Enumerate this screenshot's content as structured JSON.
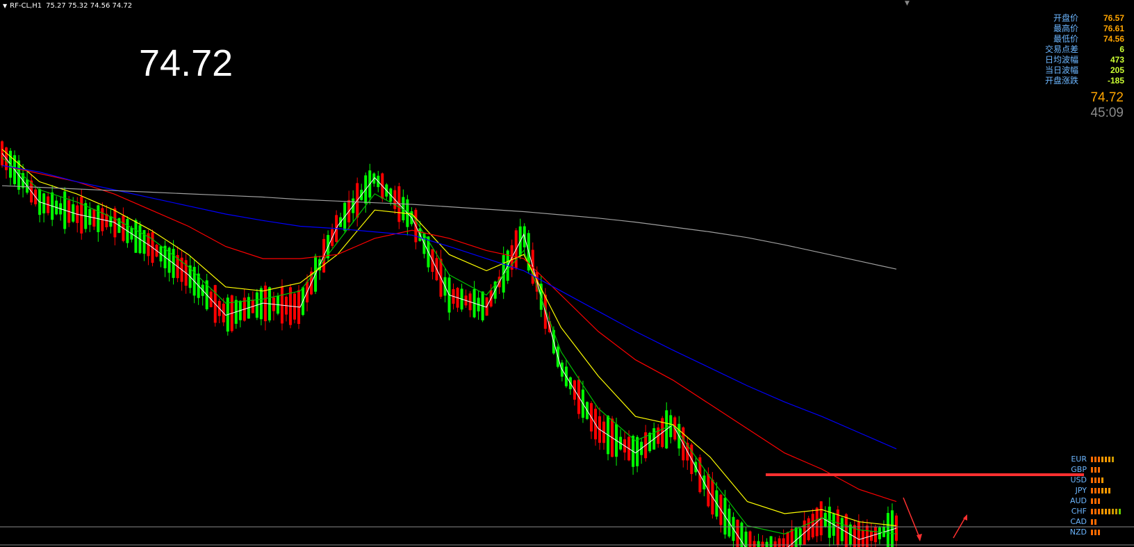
{
  "header": {
    "symbol": "RF-CL,H1",
    "ohlc": "75.27 75.32 74.56 74.72"
  },
  "big_price": "74.72",
  "info_panel": [
    {
      "label": "开盘价",
      "value": "76.57",
      "color": "#ffa500"
    },
    {
      "label": "最高价",
      "value": "76.61",
      "color": "#ffa500"
    },
    {
      "label": "最低价",
      "value": "74.56",
      "color": "#ffa500"
    },
    {
      "label": "交易点差",
      "value": "6",
      "color": "#ccff33"
    },
    {
      "label": "日均波幅",
      "value": "473",
      "color": "#ccff33"
    },
    {
      "label": "当日波幅",
      "value": "205",
      "color": "#ccff33"
    },
    {
      "label": "开盘涨跌",
      "value": "-185",
      "color": "#ccff33"
    }
  ],
  "current_price": "74.72",
  "countdown": "45:09",
  "currency_strength": [
    {
      "name": "EUR",
      "level": 7
    },
    {
      "name": "GBP",
      "level": 3
    },
    {
      "name": "USD",
      "level": 4
    },
    {
      "name": "JPY",
      "level": 6
    },
    {
      "name": "AUD",
      "level": 3
    },
    {
      "name": "CHF",
      "level": 9
    },
    {
      "name": "CAD",
      "level": 2
    },
    {
      "name": "NZD",
      "level": 3
    }
  ],
  "colors": {
    "bull": "#00ff00",
    "bear": "#ff0000",
    "ma_white": "#ffffff",
    "ma_green": "#00c000",
    "ma_yellow": "#ffff00",
    "ma_red": "#ff0000",
    "ma_blue": "#0000ff",
    "ma_gray": "#a0a0a0",
    "resistance_line": "#ff3030"
  },
  "chart_data": {
    "type": "line",
    "xlabel": "",
    "ylabel": "",
    "series": [
      {
        "values": [
          79.35,
          78.75,
          78.6,
          78.5,
          78.2,
          77.85,
          77.35,
          77.5,
          77.45,
          78.45,
          79.05,
          78.55,
          77.6,
          77.45,
          78.35,
          76.7,
          75.95,
          75.65,
          76.0,
          75.15,
          74.45,
          74.45,
          74.85,
          74.58,
          74.72
        ]
      },
      {
        "values": [
          79.3,
          78.9,
          78.75,
          78.55,
          78.3,
          77.95,
          77.5,
          77.55,
          77.65,
          78.25,
          78.85,
          78.6,
          77.85,
          77.6,
          78.15,
          76.9,
          76.2,
          75.8,
          76.0,
          75.35,
          74.75,
          74.65,
          74.85,
          74.7,
          74.65
        ]
      },
      {
        "values": [
          79.4,
          79.0,
          78.85,
          78.65,
          78.4,
          78.1,
          77.7,
          77.65,
          77.75,
          78.1,
          78.65,
          78.6,
          78.1,
          77.9,
          78.1,
          77.2,
          76.6,
          76.1,
          76.0,
          75.6,
          75.05,
          74.9,
          74.95,
          74.8,
          74.75
        ]
      },
      {
        "values": [
          79.2,
          79.1,
          79.0,
          78.85,
          78.65,
          78.45,
          78.2,
          78.05,
          78.05,
          78.1,
          78.3,
          78.4,
          78.3,
          78.15,
          78.05,
          77.6,
          77.15,
          76.8,
          76.55,
          76.25,
          75.95,
          75.65,
          75.45,
          75.2,
          75.05
        ]
      },
      {
        "values": [
          79.2,
          79.12,
          79.0,
          78.9,
          78.8,
          78.7,
          78.6,
          78.52,
          78.45,
          78.42,
          78.38,
          78.34,
          78.2,
          78.05,
          77.9,
          77.65,
          77.4,
          77.15,
          76.92,
          76.7,
          76.48,
          76.28,
          76.1,
          75.9,
          75.7
        ]
      },
      {
        "values": [
          78.95,
          78.93,
          78.91,
          78.89,
          78.87,
          78.85,
          78.83,
          78.81,
          78.78,
          78.76,
          78.74,
          78.72,
          78.69,
          78.66,
          78.63,
          78.59,
          78.55,
          78.5,
          78.44,
          78.38,
          78.31,
          78.22,
          78.12,
          78.02,
          77.92
        ]
      }
    ]
  }
}
